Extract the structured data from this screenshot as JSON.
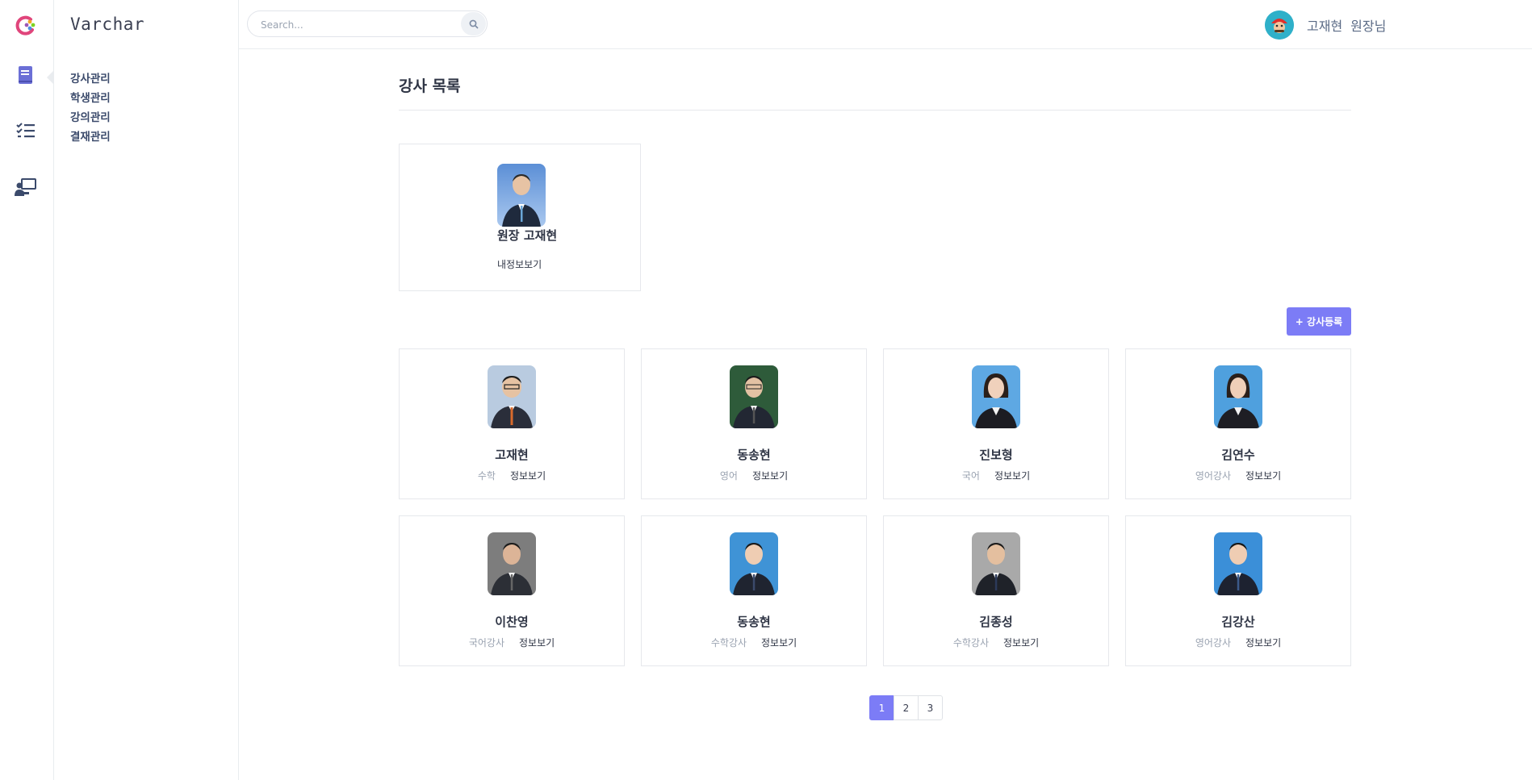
{
  "app": {
    "brand": "Varchar"
  },
  "sidebar": {
    "icons": [
      "book-icon",
      "checklist-icon",
      "teacher-board-icon"
    ],
    "menu": [
      "강사관리",
      "학생관리",
      "강의관리",
      "결재관리"
    ]
  },
  "header": {
    "search_placeholder": "Search...",
    "user_name": "고재현",
    "user_role": "원장님"
  },
  "main": {
    "title": "강사 목록",
    "owner": {
      "name": "원장 고재현",
      "link": "내정보보기"
    },
    "add_button": "+ 강사등록",
    "teachers": [
      {
        "name": "고재현",
        "subject": "수학",
        "link": "정보보기"
      },
      {
        "name": "동송현",
        "subject": "영어",
        "link": "정보보기"
      },
      {
        "name": "진보형",
        "subject": "국어",
        "link": "정보보기"
      },
      {
        "name": "김연수",
        "subject": "영어강사",
        "link": "정보보기"
      },
      {
        "name": "이찬영",
        "subject": "국어강사",
        "link": "정보보기"
      },
      {
        "name": "동송현",
        "subject": "수학강사",
        "link": "정보보기"
      },
      {
        "name": "김종성",
        "subject": "수학강사",
        "link": "정보보기"
      },
      {
        "name": "김강산",
        "subject": "영어강사",
        "link": "정보보기"
      }
    ],
    "pagination": {
      "pages": [
        "1",
        "2",
        "3"
      ],
      "current": "1"
    }
  },
  "colors": {
    "accent": "#7c7cf6",
    "text": "#2f3545",
    "muted": "#9aa3b1",
    "border": "#e6e8ec"
  }
}
